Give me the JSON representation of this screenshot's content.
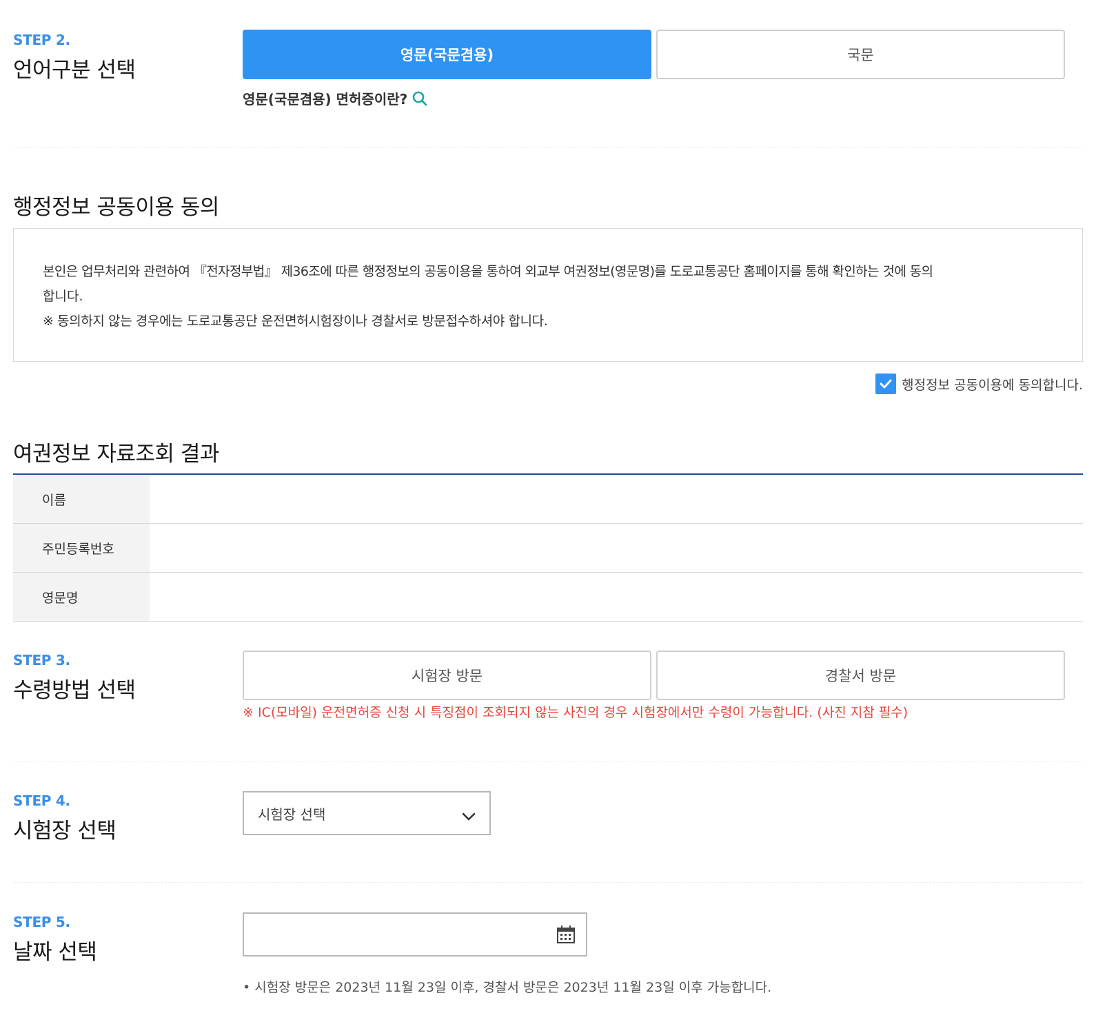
{
  "step2": {
    "label": "STEP 2.",
    "title": "언어구분 선택",
    "option_english": "영문(국문겸용)",
    "option_korean": "국문",
    "help_link": "영문(국문겸용) 면허증이란?"
  },
  "consent": {
    "title": "행정정보 공동이용 동의",
    "body_line1": "본인은 업무처리와 관련하여 『전자정부법』 제36조에 따른 행정정보의 공동이용을 통하여 외교부 여권정보(영문명)를 도로교통공단 홈페이지를 통해 확인하는 것에 동의",
    "body_line2": "합니다.",
    "body_note": "※ 동의하지 않는 경우에는 도로교통공단 운전면허시험장이나 경찰서로 방문접수하셔야 합니다.",
    "checkbox_label": "행정정보 공동이용에 동의합니다.",
    "checked": true
  },
  "passport": {
    "title": "여권정보 자료조회 결과",
    "rows": [
      {
        "label": "이름",
        "value": ""
      },
      {
        "label": "주민등록번호",
        "value": ""
      },
      {
        "label": "영문명",
        "value": ""
      }
    ]
  },
  "step3": {
    "label": "STEP 3.",
    "title": "수령방법 선택",
    "option_test_center": "시험장 방문",
    "option_police": "경찰서 방문",
    "warning": "※ IC(모바일) 운전면허증 신청 시 특징점이 조회되지 않는 사진의 경우 시험장에서만 수령이 가능합니다. (사진 지참 필수)"
  },
  "step4": {
    "label": "STEP 4.",
    "title": "시험장 선택",
    "select_value": "시험장 선택"
  },
  "step5": {
    "label": "STEP 5.",
    "title": "날짜 선택",
    "date_value": "",
    "note": "• 시험장 방문은 2023년 11월 23일 이후, 경찰서 방문은 2023년 11월 23일 이후 가능합니다."
  },
  "colors": {
    "accent": "#2f93f3",
    "step_label": "#3a8ee6",
    "warning": "#e8453c",
    "table_border": "#1d4f9a"
  },
  "icons": {
    "help": "search-icon",
    "checkbox": "check-icon",
    "select": "chevron-down-icon",
    "date": "calendar-icon"
  }
}
